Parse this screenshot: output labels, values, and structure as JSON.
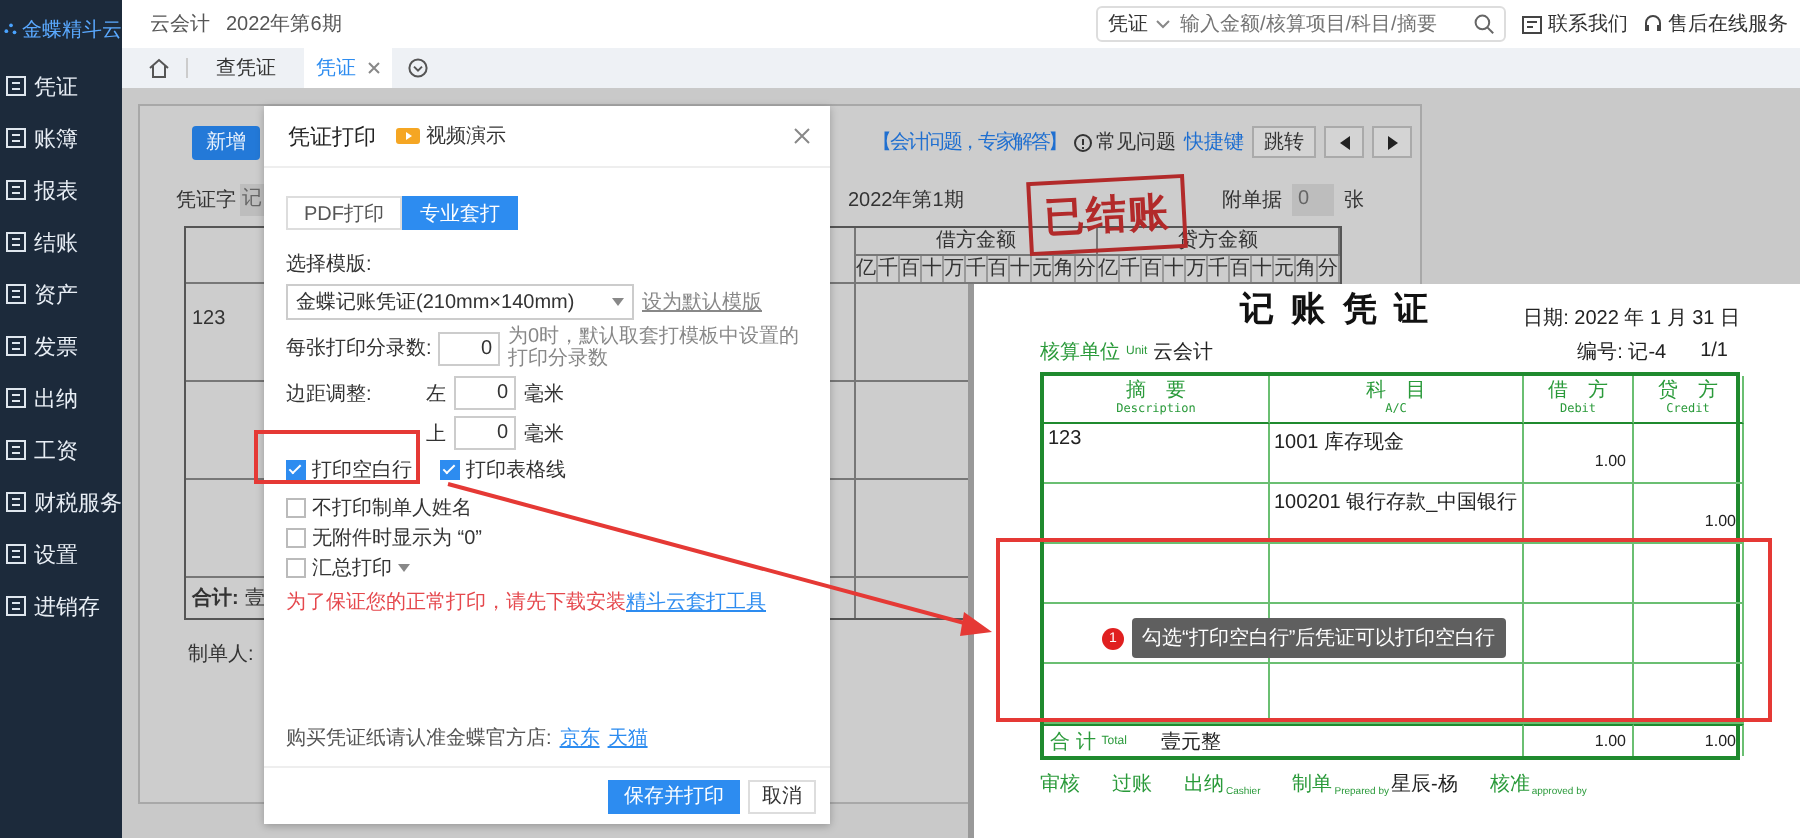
{
  "app": {
    "logo": "金蝶精斗云",
    "title": "云会计",
    "period": "2022年第6期"
  },
  "search": {
    "scope": "凭证",
    "placeholder": "输入金额/核算项目/科目/摘要"
  },
  "header_links": [
    {
      "label": "联系我们",
      "kind": "contact"
    },
    {
      "label": "售后在线服务",
      "kind": "service"
    }
  ],
  "sidebar": {
    "items": [
      {
        "label": "凭证"
      },
      {
        "label": "账簿"
      },
      {
        "label": "报表"
      },
      {
        "label": "结账"
      },
      {
        "label": "资产"
      },
      {
        "label": "发票"
      },
      {
        "label": "出纳"
      },
      {
        "label": "工资"
      },
      {
        "label": "财税服务"
      },
      {
        "label": "设置"
      },
      {
        "label": "进销存"
      }
    ]
  },
  "tabs": [
    {
      "label": "查凭证",
      "selected": false,
      "closable": false
    },
    {
      "label": "凭证",
      "selected": true,
      "closable": true
    }
  ],
  "voucher": {
    "new_button": "新增",
    "help_link": "【会计问题，专家解答】",
    "faq": "常见问题",
    "shortcut": "快捷键",
    "jump": "跳转",
    "word_label": "凭证字",
    "word_value": "记",
    "period": "2022年第1期",
    "stamp": "已结账",
    "attachments_label": "附单据",
    "attachments_value": "0",
    "attachments_unit": "张",
    "debit_header": "借方金额",
    "credit_header": "贷方金额",
    "debit_digits": [
      "亿",
      "千",
      "百",
      "十",
      "万",
      "千",
      "百",
      "十",
      "元",
      "角",
      "分"
    ],
    "credit_digits": [
      "亿",
      "千",
      "百",
      "十",
      "万",
      "千",
      "百",
      "十",
      "元",
      "角",
      "分"
    ],
    "rows": [
      {
        "summary": "123"
      },
      {},
      {}
    ],
    "total_label": "合计:",
    "total_value": "壹",
    "preparer_label": "制单人:"
  },
  "print_dialog": {
    "title": "凭证打印",
    "video_link": "视频演示",
    "modes": [
      {
        "label": "PDF打印",
        "selected": false
      },
      {
        "label": "专业套打",
        "selected": true
      }
    ],
    "template_label": "选择模版:",
    "template_value": "金蝶记账凭证(210mm×140mm)",
    "set_default_link": "设为默认模版",
    "entries_label": "每张打印分录数:",
    "entries_value": "0",
    "entries_hint": "为0时，默认取套打模板中设置的打印分录数",
    "margin_label": "边距调整:",
    "margins": [
      {
        "side": "左",
        "value": "0",
        "unit": "毫米"
      },
      {
        "side": "上",
        "value": "0",
        "unit": "毫米"
      }
    ],
    "option_rows": [
      [
        {
          "label": "打印空白行",
          "checked": true,
          "dropdown": false
        },
        {
          "label": "打印表格线",
          "checked": true,
          "dropdown": false
        }
      ],
      [
        {
          "label": "不打印制单人姓名",
          "checked": false,
          "dropdown": false
        }
      ],
      [
        {
          "label": "无附件时显示为 “0”",
          "checked": false,
          "dropdown": false
        }
      ],
      [
        {
          "label": "汇总打印",
          "checked": false,
          "dropdown": true
        }
      ]
    ],
    "warning": "为了保证您的正常打印，请先下载安装",
    "warning_link": "精斗云套打工具",
    "shop_note": "购买凭证纸请认准金蝶官方店:",
    "shop_links": [
      "京东",
      "天猫"
    ],
    "buttons": [
      {
        "label": "保存并打印",
        "primary": true
      },
      {
        "label": "取消",
        "primary": false
      }
    ]
  },
  "preview": {
    "title": "记 账 凭 证",
    "date": "日期: 2022 年 1 月 31 日",
    "unit_label": "核算单位",
    "unit_label_en": "Unit",
    "unit_value": "云会计",
    "number": "编号: 记-4",
    "page": "1/1",
    "columns": [
      {
        "cn": "摘　要",
        "en": "Description"
      },
      {
        "cn": "科　目",
        "en": "A/C"
      },
      {
        "cn": "借　方",
        "en": "Debit"
      },
      {
        "cn": "贷　方",
        "en": "Credit"
      }
    ],
    "rows": [
      {
        "kind": "entry",
        "description": "123",
        "account": "1001 库存现金",
        "debit": "1.00"
      },
      {
        "kind": "entry",
        "account": "100201 银行存款_中国银行",
        "credit": "1.00"
      },
      {
        "kind": "blank"
      },
      {
        "kind": "blank"
      },
      {
        "kind": "blank"
      }
    ],
    "total_label": "合 计",
    "total_label_en": "Total",
    "total_words": "壹元整",
    "total_debit": "1.00",
    "total_credit": "1.00",
    "signatures": [
      {
        "cn": "审核"
      },
      {
        "cn": "过账"
      },
      {
        "cn": "出纳",
        "en": "Cashier"
      },
      {
        "cn": "制单",
        "en": "Prepared by",
        "value": "星辰-杨"
      },
      {
        "cn": "核准",
        "en": "approved by"
      }
    ]
  },
  "annotation": {
    "badge": "1",
    "text": "勾选“打印空白行”后凭证可以打印空白行"
  }
}
